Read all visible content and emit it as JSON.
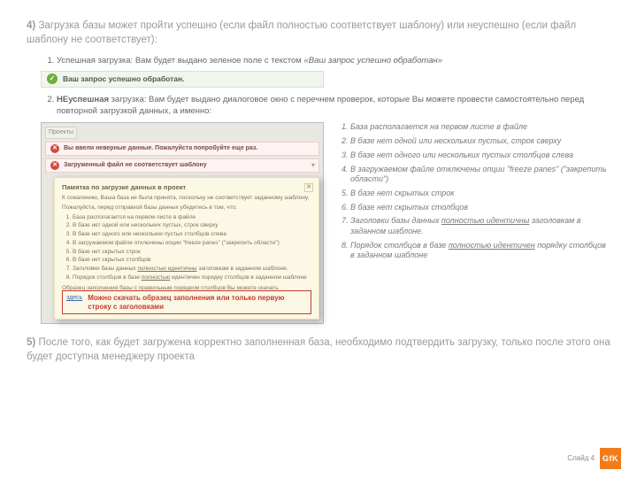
{
  "section4": {
    "num": "4)",
    "text": "Загрузка базы может пройти успешно (если файл полностью соответствует шаблону) или неуспешно (если файл шаблону не соответствует):"
  },
  "items": {
    "success_label_prefix": "Успешная загрузка: Вам будет выдано зеленое поле с текстом ",
    "success_label_quote": "«Ваш запрос успешно обработан»",
    "unsuccess_prefix": "НЕуспешная",
    "unsuccess_rest": " загрузка: Вам будет выдано диалоговое окно с перечнем проверок, которые Вы можете провести самостоятельно перед повторной загрузкой данных, а именно:"
  },
  "success_bar": "Ваш запрос успешно обработан.",
  "shot": {
    "tab": "Проекты",
    "err1": "Вы ввели неверные данные. Пожалуйста попробуйте еще раз.",
    "err2": "Загруженный файл не соответствует шаблону"
  },
  "memo": {
    "title": "Памятка по загрузке данных в проект",
    "lead": "К сожалению, Ваша база не была принята, поскольку не соответствует заданному шаблону.",
    "check_intro": "Пожалуйста, перед отправкой базы данных убедитесь в том, что:",
    "pts": [
      "База располагается на первом листе в файле",
      "В базе нет одной или нескольких пустых, строк сверху",
      "В базе нет одного или нескольких пустых столбцов слева",
      "В загружаемом файле отключены опции \"freeze panes\" (\"закрепить области\")",
      "В базе нет скрытых строк",
      "В базе нет скрытых столбцов",
      "Заголовки базы данных полностью идентичны заголовкам в заданном шаблоне.",
      "Порядок столбцов в базе полностью идентичен порядку столбцов в заданном шаблоне"
    ],
    "tail": "Образец заполнения базы с правильным порядком столбцов Вы можете скачать",
    "here": "здесь",
    "dl_caption": "Можно скачать образец заполнения или только первую строку с заголовками"
  },
  "checklist": [
    "База располагается на первом листе в файле",
    "В базе нет одной или нескольких пустых, строк сверху",
    "В базе нет одного или нескольких пустых столбцов слева",
    "В загружаемом файле отключены опции \"freeze panes\" (\"закрепить области\")",
    "В базе нет скрытых строк",
    "В базе нет скрытых столбцов",
    {
      "pre": "Заголовки базы данных ",
      "ul": "полностью идентичны",
      "post": " заголовкам в заданном шаблоне."
    },
    {
      "pre": "Порядок столбцов в базе ",
      "ul": "полностью идентичен",
      "post": " порядку столбцов в заданном шаблоне"
    }
  ],
  "section5": {
    "num": "5)",
    "text": "После того, как будет загружена корректно заполненная база, необходимо подтвердить загрузку, только после этого она будет доступна менеджеру проекта"
  },
  "footer": {
    "slide": "Слайд 4",
    "logo": "GfK"
  }
}
